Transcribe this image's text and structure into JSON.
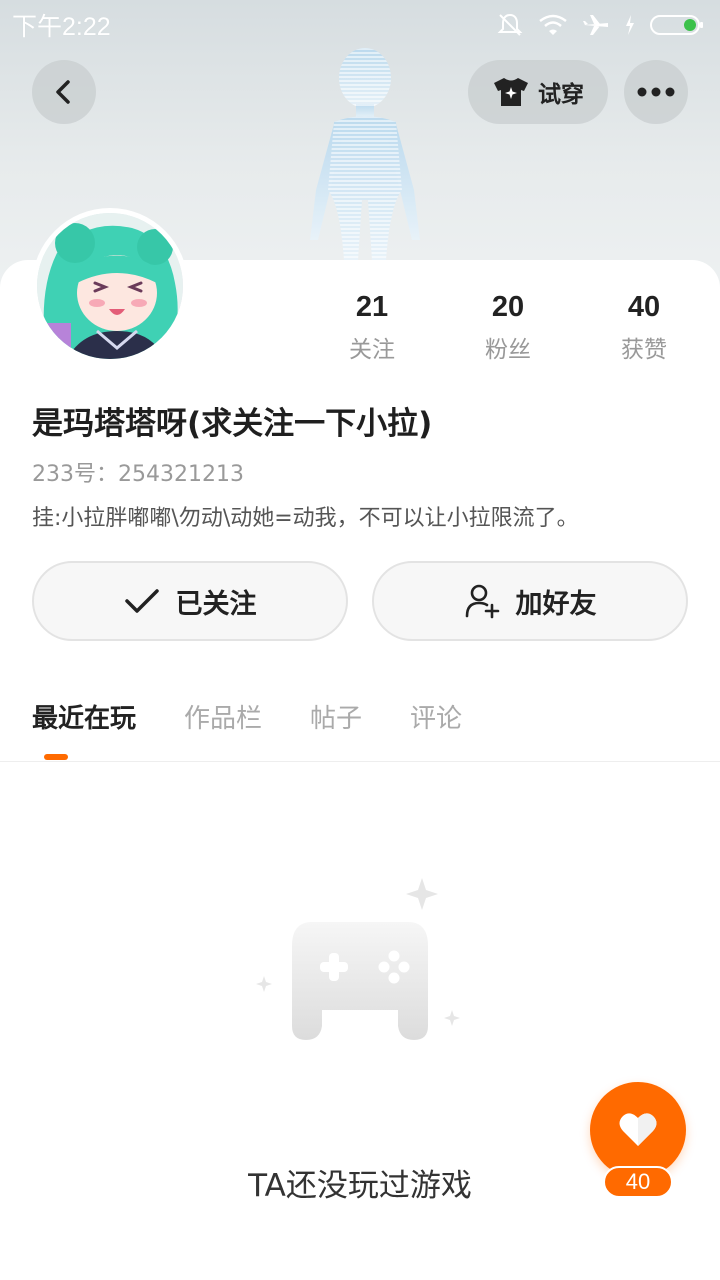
{
  "status_bar": {
    "time": "下午2:22",
    "icons": [
      "mute-icon",
      "wifi-icon",
      "airplane-icon",
      "charging-icon",
      "battery-icon"
    ]
  },
  "header": {
    "back_icon": "chevron-left-icon",
    "tryon_label": "试穿",
    "tryon_icon": "tshirt-sparkle-icon",
    "more_icon": "more-dots-icon"
  },
  "profile": {
    "nickname": "是玛塔塔呀(求关注一下小拉)",
    "user_id": "233号：254321213",
    "bio": "挂:小拉胖嘟嘟\\勿动\\动她=动我，不可以让小拉限流了。"
  },
  "stats": [
    {
      "value": "21",
      "label": "关注"
    },
    {
      "value": "20",
      "label": "粉丝"
    },
    {
      "value": "40",
      "label": "获赞"
    }
  ],
  "actions": {
    "followed_label": "已关注",
    "add_friend_label": "加好友"
  },
  "tabs": [
    {
      "label": "最近在玩",
      "active": true
    },
    {
      "label": "作品栏",
      "active": false
    },
    {
      "label": "帖子",
      "active": false
    },
    {
      "label": "评论",
      "active": false
    }
  ],
  "empty_state": {
    "text": "TA还没玩过游戏",
    "icon": "gamepad-icon"
  },
  "like_fab": {
    "count": "40",
    "icon": "heart-icon"
  },
  "colors": {
    "accent": "#ff6a00",
    "hero_bg": "#e2e7e9"
  }
}
